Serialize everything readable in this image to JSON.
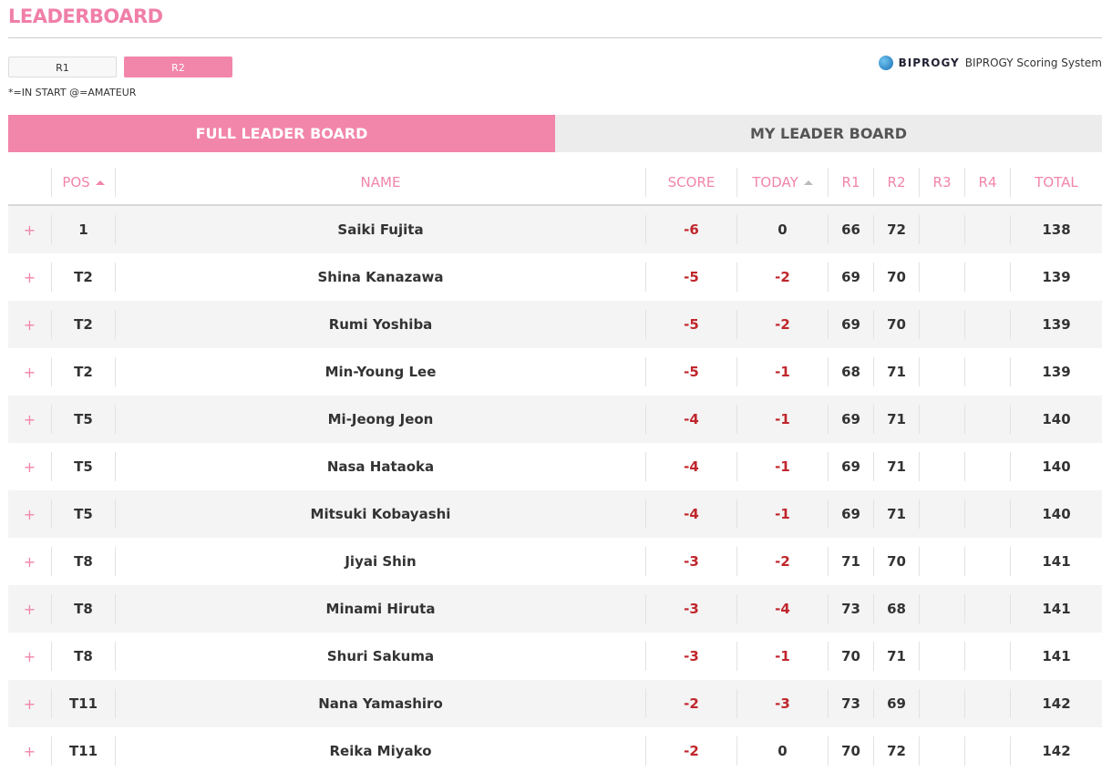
{
  "title": "LEADERBOARD",
  "rounds": [
    "R1",
    "R2"
  ],
  "legend": "*=IN START @=AMATEUR",
  "brand": {
    "name": "BIPROGY",
    "subtitle": "BIPROGY Scoring System"
  },
  "tabs": [
    "FULL LEADER BOARD",
    "MY LEADER BOARD"
  ],
  "columns": {
    "pos": "POS",
    "name": "NAME",
    "score": "SCORE",
    "today": "TODAY",
    "r1": "R1",
    "r2": "R2",
    "r3": "R3",
    "r4": "R4",
    "total": "TOTAL"
  },
  "expand_symbol": "+",
  "players": [
    {
      "pos": "1",
      "name": "Saiki Fujita",
      "score": "-6",
      "today": "0",
      "r1": "66",
      "r2": "72",
      "r3": "",
      "r4": "",
      "total": "138"
    },
    {
      "pos": "T2",
      "name": "Shina Kanazawa",
      "score": "-5",
      "today": "-2",
      "r1": "69",
      "r2": "70",
      "r3": "",
      "r4": "",
      "total": "139"
    },
    {
      "pos": "T2",
      "name": "Rumi Yoshiba",
      "score": "-5",
      "today": "-2",
      "r1": "69",
      "r2": "70",
      "r3": "",
      "r4": "",
      "total": "139"
    },
    {
      "pos": "T2",
      "name": "Min-Young Lee",
      "score": "-5",
      "today": "-1",
      "r1": "68",
      "r2": "71",
      "r3": "",
      "r4": "",
      "total": "139"
    },
    {
      "pos": "T5",
      "name": "Mi-Jeong Jeon",
      "score": "-4",
      "today": "-1",
      "r1": "69",
      "r2": "71",
      "r3": "",
      "r4": "",
      "total": "140"
    },
    {
      "pos": "T5",
      "name": "Nasa Hataoka",
      "score": "-4",
      "today": "-1",
      "r1": "69",
      "r2": "71",
      "r3": "",
      "r4": "",
      "total": "140"
    },
    {
      "pos": "T5",
      "name": "Mitsuki Kobayashi",
      "score": "-4",
      "today": "-1",
      "r1": "69",
      "r2": "71",
      "r3": "",
      "r4": "",
      "total": "140"
    },
    {
      "pos": "T8",
      "name": "Jiyai Shin",
      "score": "-3",
      "today": "-2",
      "r1": "71",
      "r2": "70",
      "r3": "",
      "r4": "",
      "total": "141"
    },
    {
      "pos": "T8",
      "name": "Minami Hiruta",
      "score": "-3",
      "today": "-4",
      "r1": "73",
      "r2": "68",
      "r3": "",
      "r4": "",
      "total": "141"
    },
    {
      "pos": "T8",
      "name": "Shuri Sakuma",
      "score": "-3",
      "today": "-1",
      "r1": "70",
      "r2": "71",
      "r3": "",
      "r4": "",
      "total": "141"
    },
    {
      "pos": "T11",
      "name": "Nana Yamashiro",
      "score": "-2",
      "today": "-3",
      "r1": "73",
      "r2": "69",
      "r3": "",
      "r4": "",
      "total": "142"
    },
    {
      "pos": "T11",
      "name": "Reika Miyako",
      "score": "-2",
      "today": "0",
      "r1": "70",
      "r2": "72",
      "r3": "",
      "r4": "",
      "total": "142"
    }
  ],
  "colors": {
    "accent": "#f285aa",
    "negative": "#c0262c",
    "tab_inactive": "#ececec"
  }
}
